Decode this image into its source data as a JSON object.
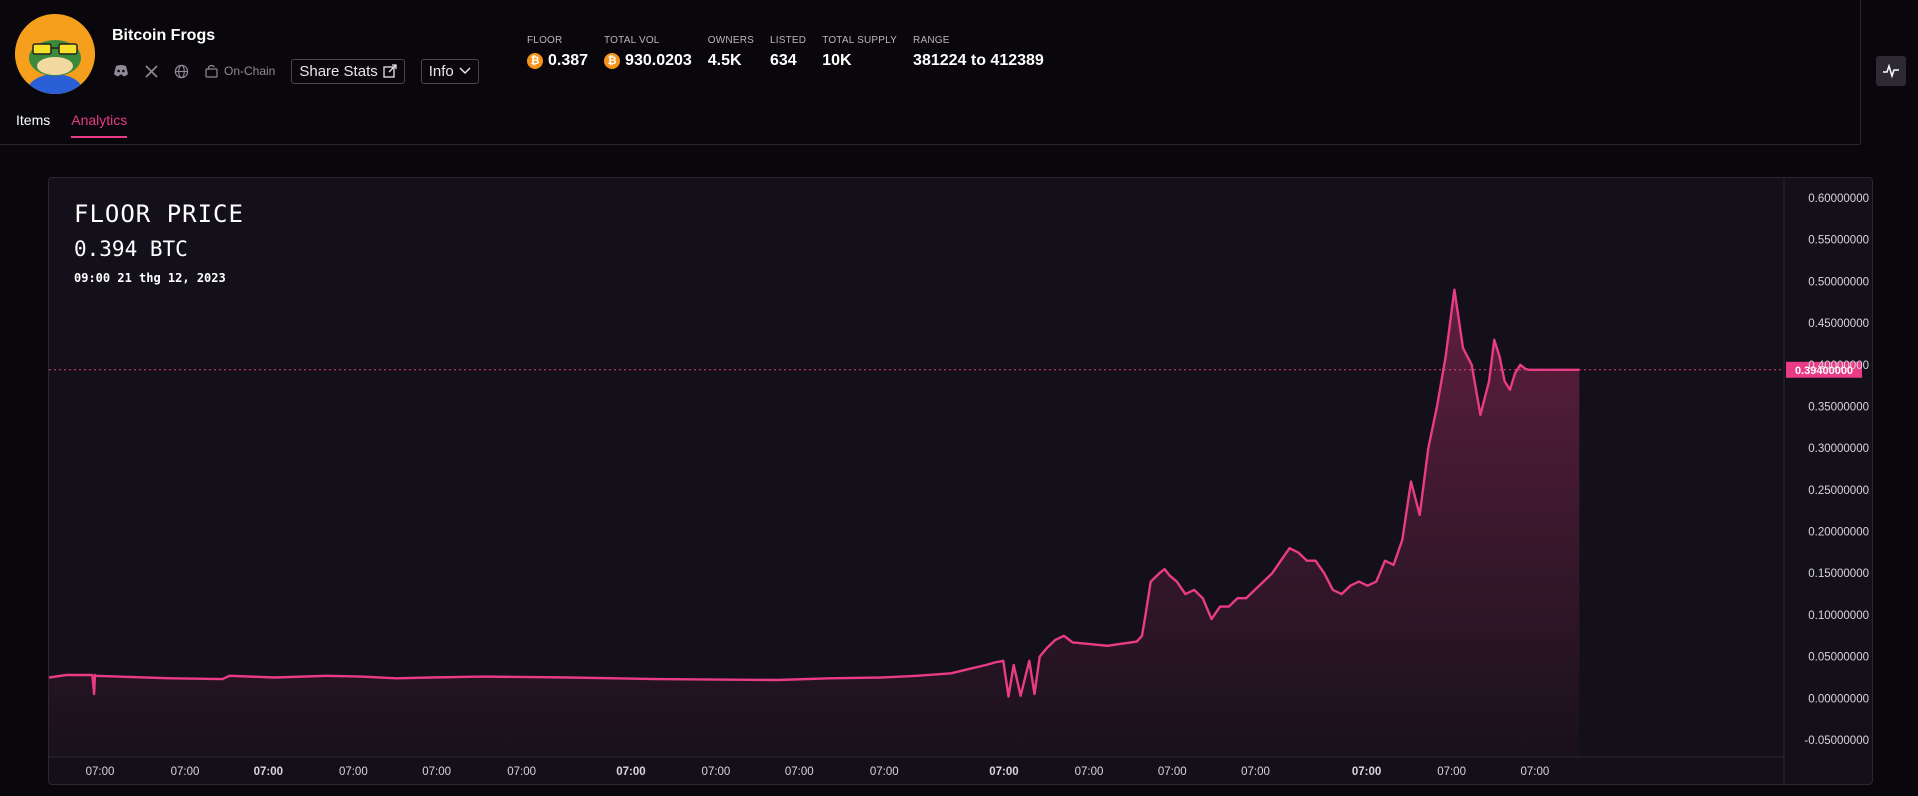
{
  "collection": {
    "name": "Bitcoin Frogs",
    "onchain_label": "On-Chain",
    "share_label": "Share Stats",
    "info_label": "Info"
  },
  "stats": [
    {
      "label": "FLOOR",
      "value": "0.387",
      "coin": true
    },
    {
      "label": "TOTAL VOL",
      "value": "930.0203",
      "coin": true
    },
    {
      "label": "OWNERS",
      "value": "4.5K",
      "coin": false
    },
    {
      "label": "LISTED",
      "value": "634",
      "coin": false
    },
    {
      "label": "TOTAL SUPPLY",
      "value": "10K",
      "coin": false
    },
    {
      "label": "RANGE",
      "value": "381224 to 412389",
      "coin": false
    }
  ],
  "tabs": {
    "items": "Items",
    "analytics": "Analytics"
  },
  "chart_header": {
    "title": "FLOOR PRICE",
    "value": "0.394 BTC",
    "date": "09:00 21 thg 12, 2023"
  },
  "colors": {
    "accent": "#e93b86",
    "background": "#09070b",
    "panel": "#141019"
  },
  "chart_data": {
    "type": "area",
    "title": "FLOOR PRICE",
    "ylim": [
      -0.05,
      0.6
    ],
    "y_ticks": [
      "0.60000000",
      "0.55000000",
      "0.50000000",
      "0.45000000",
      "0.40000000",
      "0.35000000",
      "0.30000000",
      "0.25000000",
      "0.20000000",
      "0.15000000",
      "0.10000000",
      "0.05000000",
      "0.00000000",
      "-0.05000000"
    ],
    "y_tick_values": [
      0.6,
      0.55,
      0.5,
      0.45,
      0.4,
      0.35,
      0.3,
      0.25,
      0.2,
      0.15,
      0.1,
      0.05,
      0,
      -0.05
    ],
    "x_ticks": [
      "07:00",
      "07:00",
      "07:00",
      "07:00",
      "07:00",
      "07:00",
      "07:00",
      "07:00",
      "07:00",
      "07:00",
      "07:00",
      "07:00",
      "07:00",
      "07:00",
      "07:00",
      "07:00",
      "07:00"
    ],
    "x_tick_bold": [
      false,
      false,
      true,
      false,
      false,
      false,
      true,
      false,
      false,
      false,
      true,
      false,
      false,
      false,
      true,
      false,
      false
    ],
    "x_range": [
      0,
      1.0
    ],
    "x_tick_positions": [
      0.015,
      0.064,
      0.112,
      0.161,
      0.209,
      0.258,
      0.321,
      0.37,
      0.418,
      0.467,
      0.536,
      0.585,
      0.633,
      0.681,
      0.745,
      0.794,
      0.842
    ],
    "current_price": 0.394,
    "current_price_label": "0.39400000",
    "series": [
      {
        "x": [
          0,
          0.01,
          0.025,
          0.026,
          0.0265,
          0.027,
          0.04,
          0.07,
          0.1,
          0.104,
          0.13,
          0.16,
          0.18,
          0.2,
          0.22,
          0.25,
          0.3,
          0.35,
          0.42,
          0.45,
          0.48,
          0.5,
          0.52,
          0.53,
          0.54,
          0.545,
          0.55,
          0.553,
          0.556,
          0.56,
          0.565,
          0.568,
          0.571,
          0.575,
          0.58,
          0.585,
          0.59,
          0.6,
          0.61,
          0.62,
          0.627,
          0.63,
          0.632,
          0.635,
          0.64,
          0.643,
          0.646,
          0.65,
          0.655,
          0.66,
          0.665,
          0.67,
          0.675,
          0.68,
          0.685,
          0.69,
          0.695,
          0.7,
          0.705,
          0.71,
          0.715,
          0.72,
          0.725,
          0.73,
          0.735,
          0.74,
          0.745,
          0.75,
          0.755,
          0.76,
          0.765,
          0.77,
          0.775,
          0.78,
          0.785,
          0.79,
          0.795,
          0.8,
          0.805,
          0.81,
          0.815,
          0.82,
          0.825,
          0.83,
          0.833,
          0.836,
          0.839,
          0.842,
          0.845,
          0.848,
          0.851,
          0.853,
          0.855,
          0.857,
          0.859,
          0.861,
          0.863,
          0.865,
          0.868,
          0.871,
          0.874,
          0.877,
          0.88,
          0.882
        ],
        "y": [
          0.025,
          0.028,
          0.028,
          0.005,
          0.028,
          0.027,
          0.026,
          0.024,
          0.023,
          0.027,
          0.025,
          0.027,
          0.026,
          0.024,
          0.025,
          0.026,
          0.025,
          0.023,
          0.022,
          0.024,
          0.025,
          0.027,
          0.03,
          0.035,
          0.04,
          0.043,
          0.045,
          0.002,
          0.04,
          0.003,
          0.045,
          0.005,
          0.05,
          0.06,
          0.07,
          0.075,
          0.067,
          0.065,
          0.063,
          0.066,
          0.068,
          0.075,
          0.1,
          0.14,
          0.15,
          0.155,
          0.147,
          0.14,
          0.125,
          0.13,
          0.12,
          0.095,
          0.11,
          0.11,
          0.12,
          0.12,
          0.13,
          0.14,
          0.15,
          0.165,
          0.18,
          0.175,
          0.165,
          0.165,
          0.15,
          0.13,
          0.125,
          0.135,
          0.14,
          0.135,
          0.14,
          0.165,
          0.16,
          0.19,
          0.26,
          0.22,
          0.3,
          0.35,
          0.41,
          0.49,
          0.42,
          0.4,
          0.34,
          0.38,
          0.43,
          0.41,
          0.38,
          0.37,
          0.39,
          0.4,
          0.395,
          0.394,
          0.394,
          0.394,
          0.394,
          0.394,
          0.394,
          0.394,
          0.394,
          0.394,
          0.394,
          0.394,
          0.394,
          0.394
        ]
      }
    ]
  }
}
